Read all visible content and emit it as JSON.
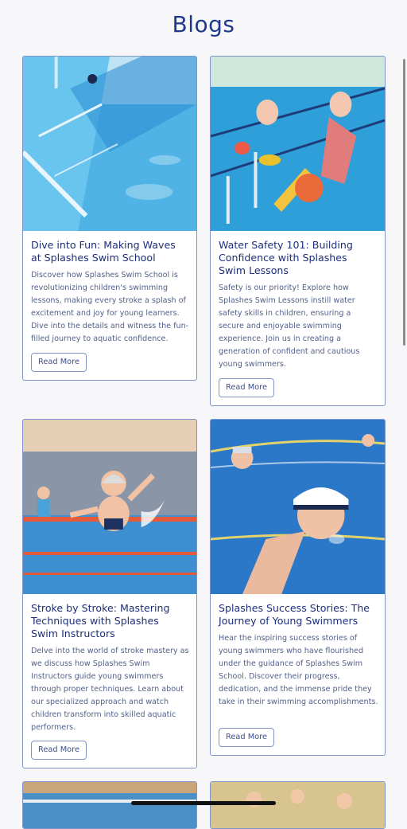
{
  "page": {
    "title": "Blogs"
  },
  "posts": [
    {
      "title": "Dive into Fun: Making Waves at Splashes Swim School",
      "description": "Discover how Splashes Swim School is revolutionizing children's swimming lessons, making every stroke a splash of excitement and joy for young learners. Dive into the details and witness the fun-filled journey to aquatic confidence.",
      "button": "Read More"
    },
    {
      "title": "Water Safety 101: Building Confidence with Splashes Swim Lessons",
      "description": "Safety is our priority! Explore how Splashes Swim Lessons instill water safety skills in children, ensuring a secure and enjoyable swimming experience. Join us in creating a generation of confident and cautious young swimmers.",
      "button": "Read More"
    },
    {
      "title": "Stroke by Stroke: Mastering Techniques with Splashes Swim Instructors",
      "description": "Delve into the world of stroke mastery as we discuss how Splashes Swim Instructors guide young swimmers through proper techniques. Learn about our specialized approach and watch children transform into skilled aquatic performers.",
      "button": "Read More"
    },
    {
      "title": "Splashes Success Stories: The Journey of Young Swimmers",
      "description": "Hear the inspiring success stories of young swimmers who have flourished under the guidance of Splashes Swim School. Discover their progress, dedication, and the immense pride they take in their swimming accomplishments.",
      "button": "Read More"
    }
  ],
  "colors": {
    "accent": "#1f3a8a",
    "card_border": "#7f95c9",
    "pool_blue": "#3ea6e0"
  }
}
